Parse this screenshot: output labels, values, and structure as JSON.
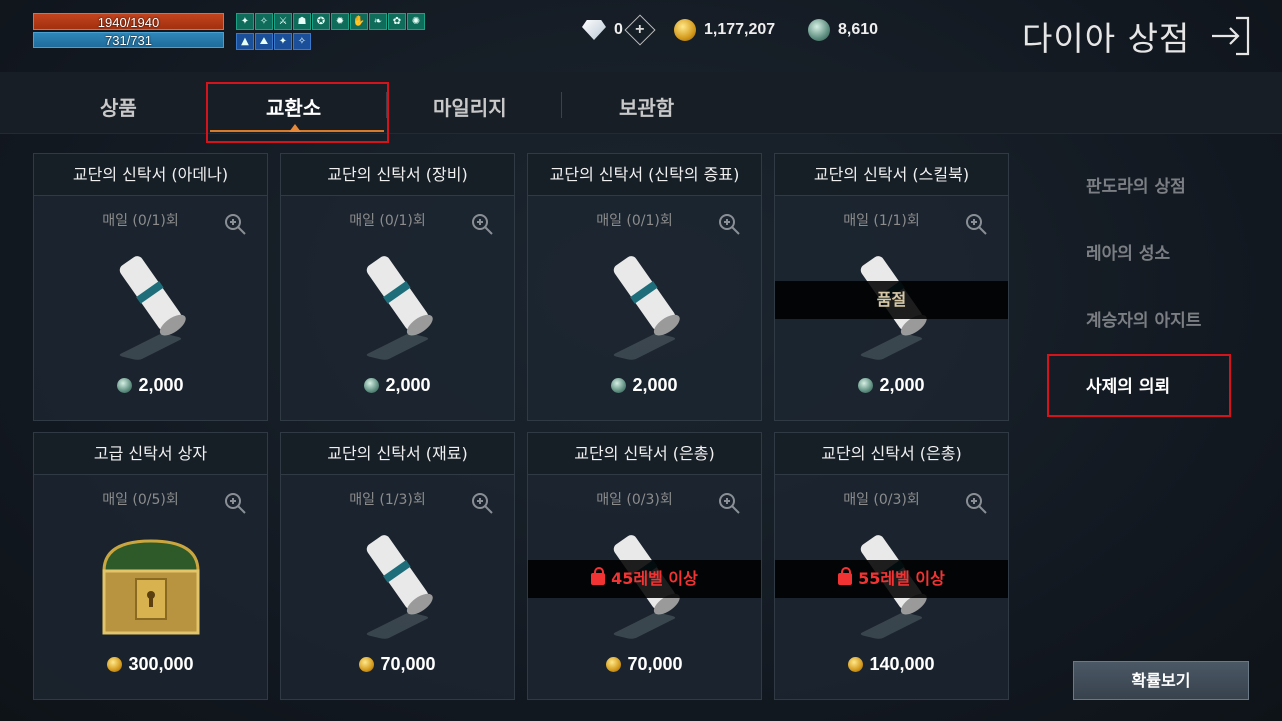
{
  "status": {
    "hp": "1940/1940",
    "mp": "731/731"
  },
  "buffs": {
    "row1": [
      "✦",
      "✧",
      "⚔",
      "☗",
      "✪",
      "✹",
      "✋",
      "❧",
      "✿",
      "✺"
    ],
    "row2": [
      "▲",
      "⛰",
      "✦",
      "✧"
    ]
  },
  "currencies": {
    "diamond": "0",
    "gold": "1,177,207",
    "mileage": "8,610",
    "add_label": "+"
  },
  "shop": {
    "title": "다이아 상점"
  },
  "tabs": [
    {
      "label": "상품"
    },
    {
      "label": "교환소"
    },
    {
      "label": "마일리지"
    },
    {
      "label": "보관함"
    }
  ],
  "items": [
    {
      "title": "교단의 신탁서 (아데나)",
      "limit": "매일 (0/1)회",
      "price": "2,000",
      "currency": "mileage"
    },
    {
      "title": "교단의 신탁서 (장비)",
      "limit": "매일 (0/1)회",
      "price": "2,000",
      "currency": "mileage"
    },
    {
      "title": "교단의 신탁서 (신탁의 증표)",
      "limit": "매일 (0/1)회",
      "price": "2,000",
      "currency": "mileage"
    },
    {
      "title": "교단의 신탁서 (스킬북)",
      "limit": "매일 (1/1)회",
      "price": "2,000",
      "currency": "mileage",
      "overlay": "품절"
    },
    {
      "title": "고급 신탁서 상자",
      "limit": "매일 (0/5)회",
      "price": "300,000",
      "currency": "gold"
    },
    {
      "title": "교단의 신탁서 (재료)",
      "limit": "매일 (1/3)회",
      "price": "70,000",
      "currency": "gold"
    },
    {
      "title": "교단의 신탁서 (은총)",
      "limit": "매일 (0/3)회",
      "price": "70,000",
      "currency": "gold",
      "overlay": "45레벨 이상"
    },
    {
      "title": "교단의 신탁서 (은총)",
      "limit": "매일 (0/3)회",
      "price": "140,000",
      "currency": "gold",
      "overlay": "55레벨 이상"
    }
  ],
  "side_menu": [
    {
      "label": "판도라의 상점"
    },
    {
      "label": "레아의 성소"
    },
    {
      "label": "계승자의 아지트"
    },
    {
      "label": "사제의 의뢰"
    }
  ],
  "probability_button": "확률보기",
  "colors": {
    "highlight_frame": "#d5131a",
    "tab_accent": "#d87a2a",
    "lock_text": "#f23333"
  }
}
